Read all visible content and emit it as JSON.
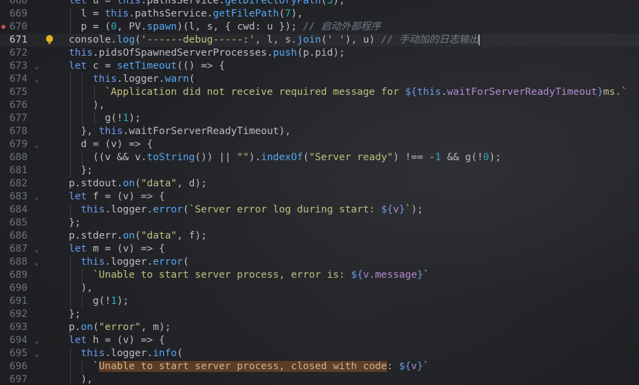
{
  "editor": {
    "lines": [
      {
        "num": "668",
        "fold": "",
        "segs": [
          {
            "t": "let ",
            "c": "t-kw"
          },
          {
            "t": "u = "
          },
          {
            "t": "this",
            "c": "t-kw"
          },
          {
            "t": ".pathsService."
          },
          {
            "t": "getDirectoryPath",
            "c": "t-fn"
          },
          {
            "t": "("
          },
          {
            "t": "3",
            "c": "t-num"
          },
          {
            "t": "),"
          }
        ],
        "indent": 0
      },
      {
        "num": "669",
        "fold": "",
        "segs": [
          {
            "t": "l = "
          },
          {
            "t": "this",
            "c": "t-kw"
          },
          {
            "t": ".pathsService."
          },
          {
            "t": "getFilePath",
            "c": "t-fn"
          },
          {
            "t": "("
          },
          {
            "t": "7",
            "c": "t-num"
          },
          {
            "t": "),"
          }
        ],
        "indent": 1
      },
      {
        "num": "670",
        "fold": "",
        "bp": true,
        "segs": [
          {
            "t": "p = ("
          },
          {
            "t": "0",
            "c": "t-num"
          },
          {
            "t": ", PV."
          },
          {
            "t": "spawn",
            "c": "t-fn"
          },
          {
            "t": ")(l, s, { cwd: u }); "
          },
          {
            "t": "// 启动外部程序",
            "c": "t-cm"
          }
        ],
        "indent": 1
      },
      {
        "num": "671",
        "fold": "",
        "active": true,
        "bulb": true,
        "segs": [
          {
            "t": "console.",
            "c": ""
          },
          {
            "t": "log",
            "c": "t-fn"
          },
          {
            "t": "("
          },
          {
            "t": "'------debug-----:'",
            "c": "t-str"
          },
          {
            "t": ", l, s."
          },
          {
            "t": "join",
            "c": "t-fn"
          },
          {
            "t": "("
          },
          {
            "t": "' '",
            "c": "t-str"
          },
          {
            "t": "), u) "
          },
          {
            "t": "// 手动加的日志输出",
            "c": "t-cm"
          }
        ],
        "indent": 0,
        "caret": true
      },
      {
        "num": "672",
        "fold": "",
        "segs": [
          {
            "t": "this",
            "c": "t-kw"
          },
          {
            "t": ".pidsOfSpawnedServerProcesses."
          },
          {
            "t": "push",
            "c": "t-fn"
          },
          {
            "t": "(p.pid);"
          }
        ],
        "indent": 0
      },
      {
        "num": "673",
        "fold": "⌄",
        "segs": [
          {
            "t": "let ",
            "c": "t-kw"
          },
          {
            "t": "c = "
          },
          {
            "t": "setTimeout",
            "c": "t-fn"
          },
          {
            "t": "(() => {"
          }
        ],
        "indent": 0
      },
      {
        "num": "674",
        "fold": "⌄",
        "segs": [
          {
            "t": "this",
            "c": "t-kw"
          },
          {
            "t": ".logger."
          },
          {
            "t": "warn",
            "c": "t-fn"
          },
          {
            "t": "("
          }
        ],
        "indent": 2
      },
      {
        "num": "675",
        "fold": "",
        "segs": [
          {
            "t": "`Application did not receive required message for ",
            "c": "t-tmpl"
          },
          {
            "t": "${",
            "c": "t-interp"
          },
          {
            "t": "this",
            "c": "t-kw"
          },
          {
            "t": "."
          },
          {
            "t": "waitForServerReadyTimeout",
            "c": "t-var"
          },
          {
            "t": "}",
            "c": "t-interp"
          },
          {
            "t": "ms.`",
            "c": "t-tmpl"
          }
        ],
        "indent": 3
      },
      {
        "num": "676",
        "fold": "",
        "segs": [
          {
            "t": "),"
          }
        ],
        "indent": 2
      },
      {
        "num": "677",
        "fold": "",
        "segs": [
          {
            "t": "g"
          },
          {
            "t": "(!"
          },
          {
            "t": "1",
            "c": "t-num"
          },
          {
            "t": ");"
          }
        ],
        "indent": 3
      },
      {
        "num": "678",
        "fold": "",
        "segs": [
          {
            "t": "}, "
          },
          {
            "t": "this",
            "c": "t-kw"
          },
          {
            "t": ".waitForServerReadyTimeout),"
          }
        ],
        "indent": 1
      },
      {
        "num": "679",
        "fold": "⌄",
        "segs": [
          {
            "t": "d = (v) => {"
          }
        ],
        "indent": 1
      },
      {
        "num": "680",
        "fold": "",
        "segs": [
          {
            "t": "((v && v."
          },
          {
            "t": "toString",
            "c": "t-fn"
          },
          {
            "t": "()) || "
          },
          {
            "t": "\"\"",
            "c": "t-str"
          },
          {
            "t": ")."
          },
          {
            "t": "indexOf",
            "c": "t-fn"
          },
          {
            "t": "("
          },
          {
            "t": "\"Server ready\"",
            "c": "t-str"
          },
          {
            "t": ") !== -"
          },
          {
            "t": "1",
            "c": "t-num"
          },
          {
            "t": " && g(!"
          },
          {
            "t": "0",
            "c": "t-num"
          },
          {
            "t": ");"
          }
        ],
        "indent": 2
      },
      {
        "num": "681",
        "fold": "",
        "segs": [
          {
            "t": "};"
          }
        ],
        "indent": 1
      },
      {
        "num": "682",
        "fold": "",
        "segs": [
          {
            "t": "p.stdout."
          },
          {
            "t": "on",
            "c": "t-fn"
          },
          {
            "t": "("
          },
          {
            "t": "\"data\"",
            "c": "t-str"
          },
          {
            "t": ", d);"
          }
        ],
        "indent": 0
      },
      {
        "num": "683",
        "fold": "⌄",
        "segs": [
          {
            "t": "let ",
            "c": "t-kw"
          },
          {
            "t": "f = (v) => {"
          }
        ],
        "indent": 0
      },
      {
        "num": "684",
        "fold": "",
        "segs": [
          {
            "t": "this",
            "c": "t-kw"
          },
          {
            "t": ".logger."
          },
          {
            "t": "error",
            "c": "t-fn"
          },
          {
            "t": "("
          },
          {
            "t": "`Server error log during start: ",
            "c": "t-tmpl"
          },
          {
            "t": "${",
            "c": "t-interp"
          },
          {
            "t": "v",
            "c": "t-var"
          },
          {
            "t": "}",
            "c": "t-interp"
          },
          {
            "t": "`",
            "c": "t-tmpl"
          },
          {
            "t": ");"
          }
        ],
        "indent": 1
      },
      {
        "num": "685",
        "fold": "",
        "segs": [
          {
            "t": "};"
          }
        ],
        "indent": 0
      },
      {
        "num": "686",
        "fold": "",
        "segs": [
          {
            "t": "p.stderr."
          },
          {
            "t": "on",
            "c": "t-fn"
          },
          {
            "t": "("
          },
          {
            "t": "\"data\"",
            "c": "t-str"
          },
          {
            "t": ", f);"
          }
        ],
        "indent": 0
      },
      {
        "num": "687",
        "fold": "⌄",
        "segs": [
          {
            "t": "let ",
            "c": "t-kw"
          },
          {
            "t": "m = (v) => {"
          }
        ],
        "indent": 0
      },
      {
        "num": "688",
        "fold": "⌄",
        "segs": [
          {
            "t": "this",
            "c": "t-kw"
          },
          {
            "t": ".logger."
          },
          {
            "t": "error",
            "c": "t-fn"
          },
          {
            "t": "("
          }
        ],
        "indent": 1
      },
      {
        "num": "689",
        "fold": "",
        "segs": [
          {
            "t": "`Unable to start server process, error is: ",
            "c": "t-tmpl"
          },
          {
            "t": "${",
            "c": "t-interp"
          },
          {
            "t": "v.message",
            "c": "t-var"
          },
          {
            "t": "}",
            "c": "t-interp"
          },
          {
            "t": "`",
            "c": "t-tmpl"
          }
        ],
        "indent": 2
      },
      {
        "num": "690",
        "fold": "",
        "segs": [
          {
            "t": "),"
          }
        ],
        "indent": 1
      },
      {
        "num": "691",
        "fold": "",
        "segs": [
          {
            "t": "g(!"
          },
          {
            "t": "1",
            "c": "t-num"
          },
          {
            "t": ");"
          }
        ],
        "indent": 2
      },
      {
        "num": "692",
        "fold": "",
        "segs": [
          {
            "t": "};"
          }
        ],
        "indent": 0
      },
      {
        "num": "693",
        "fold": "",
        "segs": [
          {
            "t": "p."
          },
          {
            "t": "on",
            "c": "t-fn"
          },
          {
            "t": "("
          },
          {
            "t": "\"error\"",
            "c": "t-str"
          },
          {
            "t": ", m);"
          }
        ],
        "indent": 0
      },
      {
        "num": "694",
        "fold": "⌄",
        "segs": [
          {
            "t": "let ",
            "c": "t-kw"
          },
          {
            "t": "h = (v) => {"
          }
        ],
        "indent": 0
      },
      {
        "num": "695",
        "fold": "⌄",
        "segs": [
          {
            "t": "this",
            "c": "t-kw"
          },
          {
            "t": ".logger."
          },
          {
            "t": "info",
            "c": "t-fn"
          },
          {
            "t": "("
          }
        ],
        "indent": 1
      },
      {
        "num": "696",
        "fold": "",
        "segs": [
          {
            "t": "`",
            "c": "t-tmpl"
          },
          {
            "t": "Unable to start server process, closed with code",
            "c": "t-hl"
          },
          {
            "t": ": ",
            "c": "t-tmpl"
          },
          {
            "t": "${",
            "c": "t-interp"
          },
          {
            "t": "v",
            "c": "t-var"
          },
          {
            "t": "}",
            "c": "t-interp"
          },
          {
            "t": "`",
            "c": "t-tmpl"
          }
        ],
        "indent": 2
      },
      {
        "num": "697",
        "fold": "",
        "segs": [
          {
            "t": "),"
          }
        ],
        "indent": 1
      }
    ]
  }
}
